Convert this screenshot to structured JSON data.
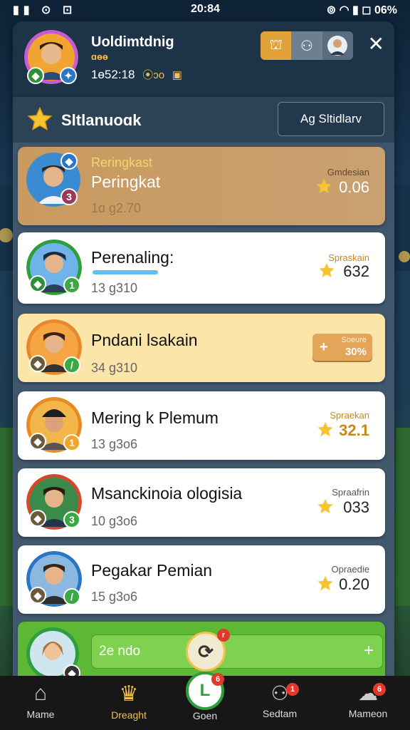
{
  "status_bar": {
    "time": "20:84",
    "battery": "06%"
  },
  "header": {
    "player_name": "Uoldimtdnig",
    "sub_label": "ɑɵɵ",
    "stat": "1ɵ52:18",
    "coins": "⦿ɔo"
  },
  "section": {
    "title": "Sltlanuoɑk",
    "button_label": "Ag Sltidlarv"
  },
  "cards": [
    {
      "sub_title": "Reringkast",
      "name": "Peringkat",
      "score": "1ɑ g2.70",
      "label": "Gmdesian",
      "value": "0.06"
    },
    {
      "name": "Perenaling:",
      "score": "13 g310",
      "label": "Spraskain",
      "value": "632"
    },
    {
      "name": "Pndani lsakain",
      "score": "34 g310",
      "label": "Soeure",
      "value": "30%"
    },
    {
      "name": "Mering k Plemum",
      "score": "13 g3o6",
      "label": "Spraekan",
      "value": "32.1"
    },
    {
      "name": "Msanckinoia ologisia",
      "score": "10 g3o6",
      "label": "Spraafrin",
      "value": "033"
    },
    {
      "name": "Pegakar Pemian",
      "score": "15 g3o6",
      "label": "Opraedie",
      "value": "0.20"
    }
  ],
  "bottom_card": {
    "input_text": "2e ndo",
    "plus": "+",
    "badge": "r"
  },
  "nav": [
    {
      "label": "Mame"
    },
    {
      "label": "Dreaght"
    },
    {
      "label": "Goen",
      "badge": "6"
    },
    {
      "label": "Sedtam",
      "badge": "1"
    },
    {
      "label": "Mameon",
      "badge": "6"
    }
  ],
  "colors": {
    "accent_gold": "#f3c04a",
    "green": "#5cb835",
    "panel": "#3d556c"
  }
}
